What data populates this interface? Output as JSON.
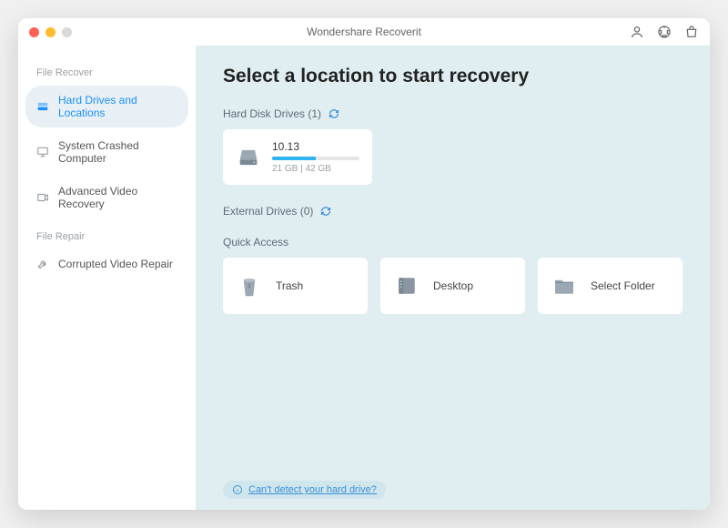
{
  "title": "Wondershare Recoverit",
  "sidebar": {
    "section1_label": "File Recover",
    "section2_label": "File Repair",
    "items": [
      {
        "label": "Hard Drives and Locations"
      },
      {
        "label": "System Crashed Computer"
      },
      {
        "label": "Advanced Video Recovery"
      },
      {
        "label": "Corrupted Video Repair"
      }
    ]
  },
  "main": {
    "heading": "Select a location to start recovery",
    "hdd_label": "Hard Disk Drives (1)",
    "ext_label": "External Drives (0)",
    "quick_label": "Quick Access",
    "drive": {
      "name": "10.13",
      "size": "21 GB | 42 GB"
    },
    "quick": [
      {
        "label": "Trash"
      },
      {
        "label": "Desktop"
      },
      {
        "label": "Select Folder"
      }
    ],
    "footer": "Can't detect your hard drive?"
  }
}
